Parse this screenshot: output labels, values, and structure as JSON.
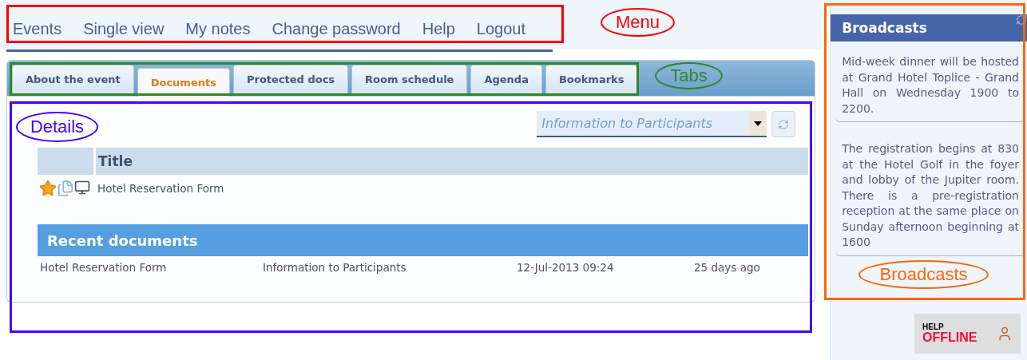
{
  "menu": [
    {
      "label": "Events"
    },
    {
      "label": "Single view"
    },
    {
      "label": "My notes"
    },
    {
      "label": "Change password"
    },
    {
      "label": "Help"
    },
    {
      "label": "Logout"
    }
  ],
  "tabs": [
    {
      "label": "About the event",
      "selected": false
    },
    {
      "label": "Documents",
      "selected": true
    },
    {
      "label": "Protected docs",
      "selected": false
    },
    {
      "label": "Room schedule",
      "selected": false
    },
    {
      "label": "Agenda",
      "selected": false
    },
    {
      "label": "Bookmarks",
      "selected": false
    }
  ],
  "filter": {
    "value": "Information to Participants"
  },
  "documents": {
    "columns": [
      "Title"
    ],
    "rows": [
      {
        "title": "Hotel Reservation Form"
      }
    ]
  },
  "recent_documents": {
    "title": "Recent documents",
    "rows": [
      {
        "name": "Hotel Reservation Form",
        "category": "Information to Participants",
        "date": "12-Jul-2013 09:24",
        "age": "25 days ago"
      }
    ]
  },
  "broadcasts": {
    "title": "Broadcasts",
    "items": [
      "Mid-week dinner will be hosted at Grand Hotel Toplice - Grand Hall on Wednesday 1900 to 2200.",
      "The registration begins at 830 at the Hotel Golf in the foyer and lobby of the Jupiter room. There is a pre-registration reception at the same place on Sunday afternoon beginning at 1600"
    ]
  },
  "help_status": {
    "label": "HELP",
    "status": "OFFLINE"
  },
  "annotations": {
    "menu": {
      "label": "Menu",
      "color": "#ff0000"
    },
    "tabs": {
      "label": "Tabs",
      "color": "#2e8b1e"
    },
    "details": {
      "label": "Details",
      "color": "#4400ff"
    },
    "broadcasts": {
      "label": "Broadcasts",
      "color": "#ff6600"
    }
  }
}
